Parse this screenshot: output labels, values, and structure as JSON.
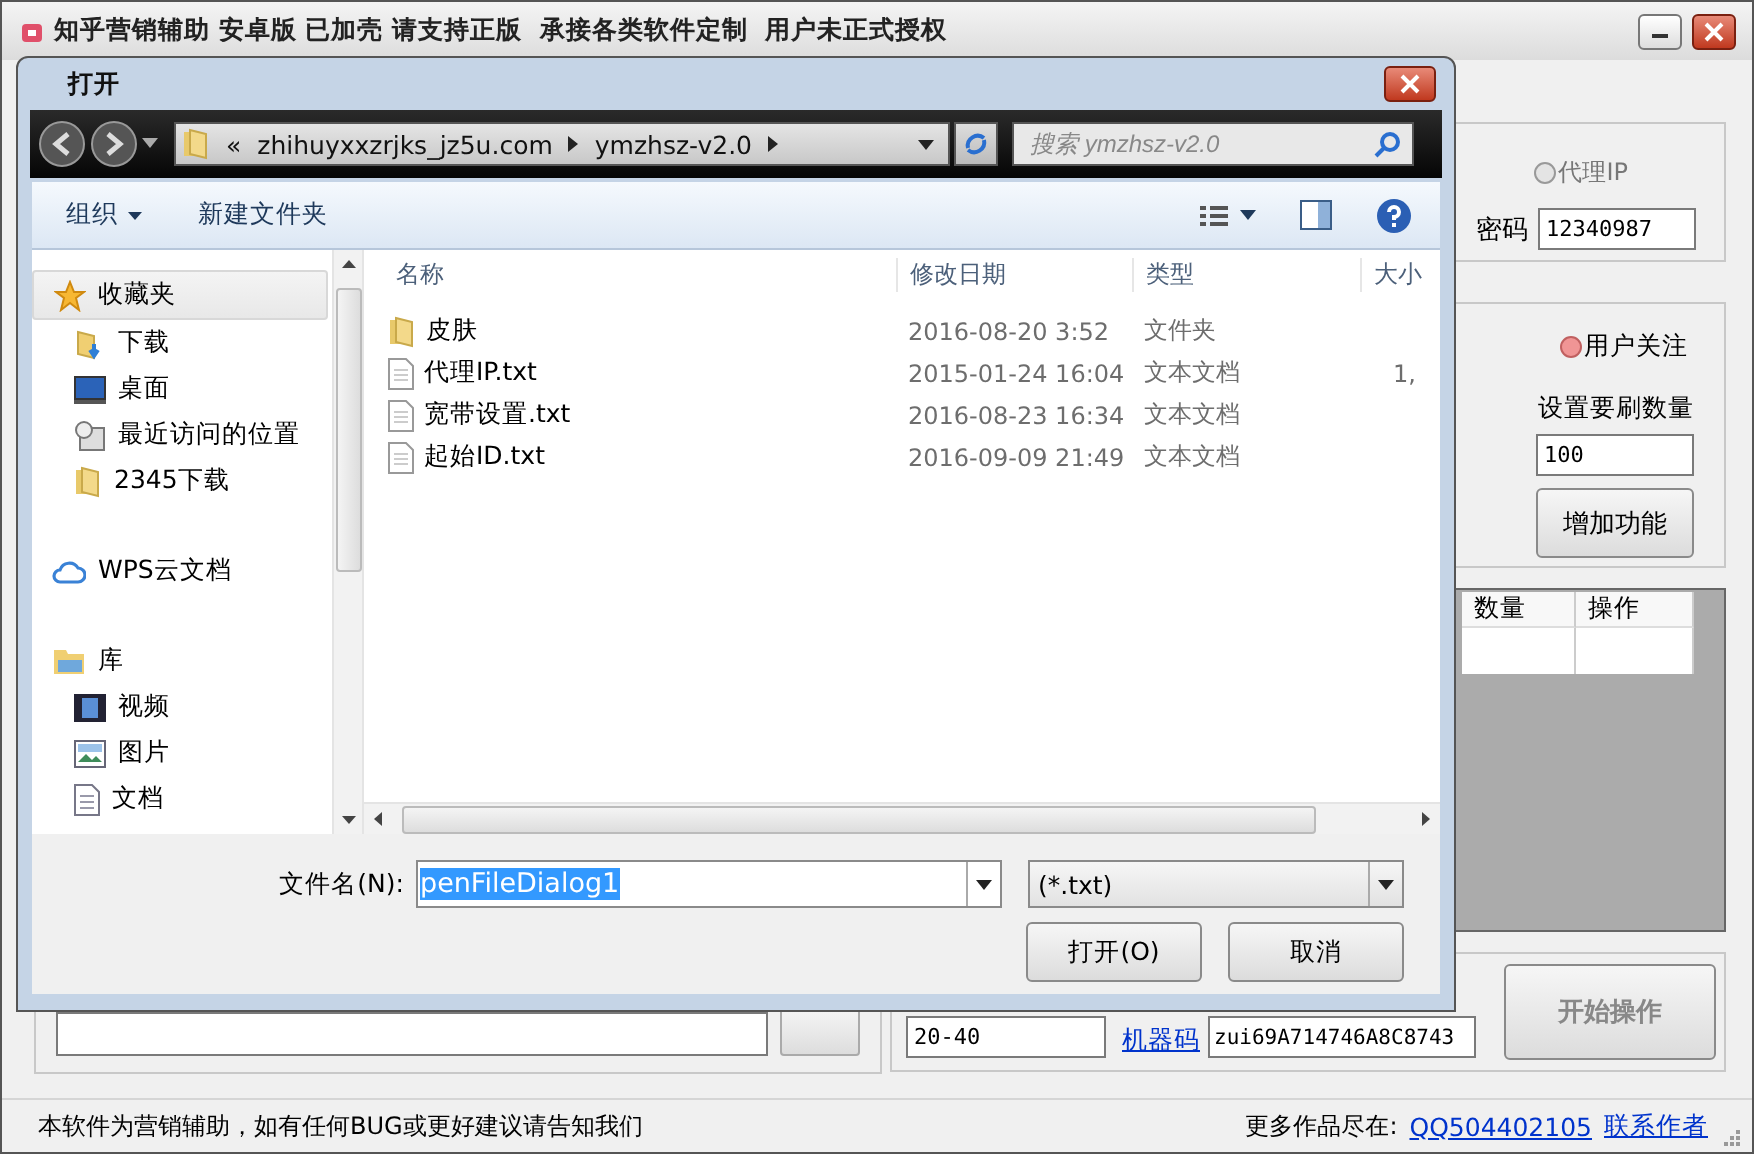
{
  "app": {
    "title": "知乎营销辅助 安卓版 已加壳 请支持正版  承接各类软件定制  用户未正式授权",
    "proxy_radio": {
      "label": "代理IP",
      "selected": false
    },
    "password": {
      "label": "密码",
      "value": "12340987"
    },
    "follow_radio": {
      "label": "用户关注",
      "selected": true
    },
    "count_label": "设置要刷数量",
    "count_value": "100",
    "add_button": "增加功能",
    "table": {
      "columns": [
        "数量",
        "操作"
      ]
    },
    "range_value": "20-40",
    "machine_code_link": "机器码",
    "machine_code": "zui69A714746A8C8743",
    "start_button": {
      "label": "开始操作",
      "disabled": true
    },
    "status": {
      "left": "本软件为营销辅助，如有任何BUG或更好建议请告知我们",
      "more_label": "更多作品尽在:",
      "qq_link": "QQ504402105",
      "contact_link": "联系作者"
    }
  },
  "dialog": {
    "title": "打开",
    "path": {
      "overflow": "«",
      "segments": [
        "zhihuyxxzrjks_jz5u.com",
        "ymzhsz-v2.0"
      ]
    },
    "search": {
      "placeholder": "搜索 ymzhsz-v2.0"
    },
    "toolbar": {
      "organize": "组织",
      "new_folder": "新建文件夹"
    },
    "nav": [
      {
        "label": "收藏夹",
        "kind": "star",
        "selected": true,
        "children": [
          {
            "label": "下载",
            "kind": "download",
            "selected": false
          },
          {
            "label": "桌面",
            "kind": "desktop",
            "selected": false
          },
          {
            "label": "最近访问的位置",
            "kind": "recent",
            "selected": false
          },
          {
            "label": "2345下载",
            "kind": "folder",
            "selected": false
          }
        ]
      },
      {
        "label": "WPS云文档",
        "kind": "cloud",
        "selected": false
      },
      {
        "label": "库",
        "kind": "library",
        "selected": false,
        "children": [
          {
            "label": "视频",
            "kind": "video",
            "selected": false
          },
          {
            "label": "图片",
            "kind": "picture",
            "selected": false
          },
          {
            "label": "文档",
            "kind": "document",
            "selected": false
          }
        ]
      }
    ],
    "columns": [
      "名称",
      "修改日期",
      "类型",
      "大小"
    ],
    "files": [
      {
        "name": "皮肤",
        "date": "2016-08-20 3:52",
        "type": "文件夹",
        "kind": "folder"
      },
      {
        "name": "代理IP.txt",
        "date": "2015-01-24 16:04",
        "type": "文本文档",
        "size": "1,",
        "kind": "text"
      },
      {
        "name": "宽带设置.txt",
        "date": "2016-08-23 16:34",
        "type": "文本文档",
        "kind": "text"
      },
      {
        "name": "起始ID.txt",
        "date": "2016-09-09 21:49",
        "type": "文本文档",
        "kind": "text"
      }
    ],
    "filename": {
      "label": "文件名(N):",
      "value": "penFileDialog1",
      "text_selected": true
    },
    "filter": "(*.txt)",
    "open_button": "打开(O)",
    "cancel_button": "取消"
  }
}
